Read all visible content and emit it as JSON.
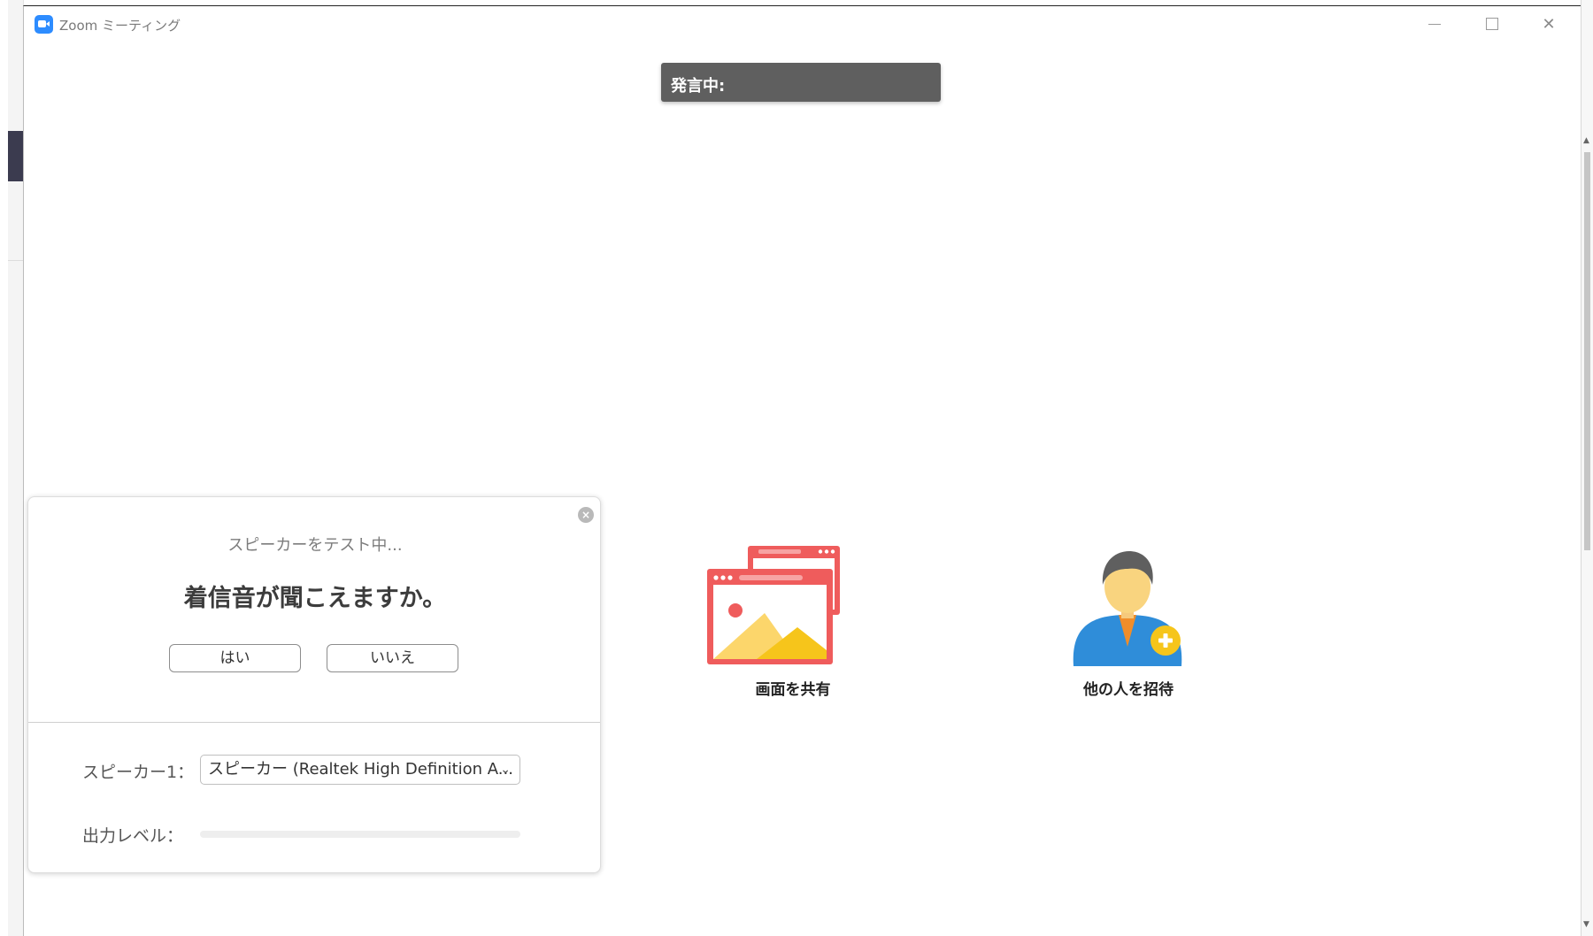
{
  "window": {
    "title": "Zoom ミーティング",
    "controls": {
      "minimize": "—",
      "maximize": "□",
      "close": "✕"
    }
  },
  "speaking_indicator": {
    "label": "発言中:"
  },
  "speaker_test": {
    "status": "スピーカーをテスト中...",
    "question": "着信音が聞こえますか。",
    "yes_label": "はい",
    "no_label": "いいえ",
    "close_glyph": "×",
    "speaker_label": "スピーカー1：",
    "speaker_value": "スピーカー (Realtek High Definition A...",
    "output_level_label": "出力レベル：",
    "output_level": 0
  },
  "actions": {
    "share_screen_label": "画面を共有",
    "invite_label": "他の人を招待"
  },
  "colors": {
    "accent": "#2d8cff",
    "badge_bg": "#5f5f5f",
    "share_red": "#ef5c5c",
    "invite_blue": "#2f8dd9",
    "invite_plus": "#f6c51b"
  },
  "icons": {
    "app": "zoom-camera-icon",
    "dialog_close": "close-circle-icon",
    "dropdown": "chevron-down-icon",
    "share": "share-screen-icon",
    "invite": "invite-person-icon"
  }
}
